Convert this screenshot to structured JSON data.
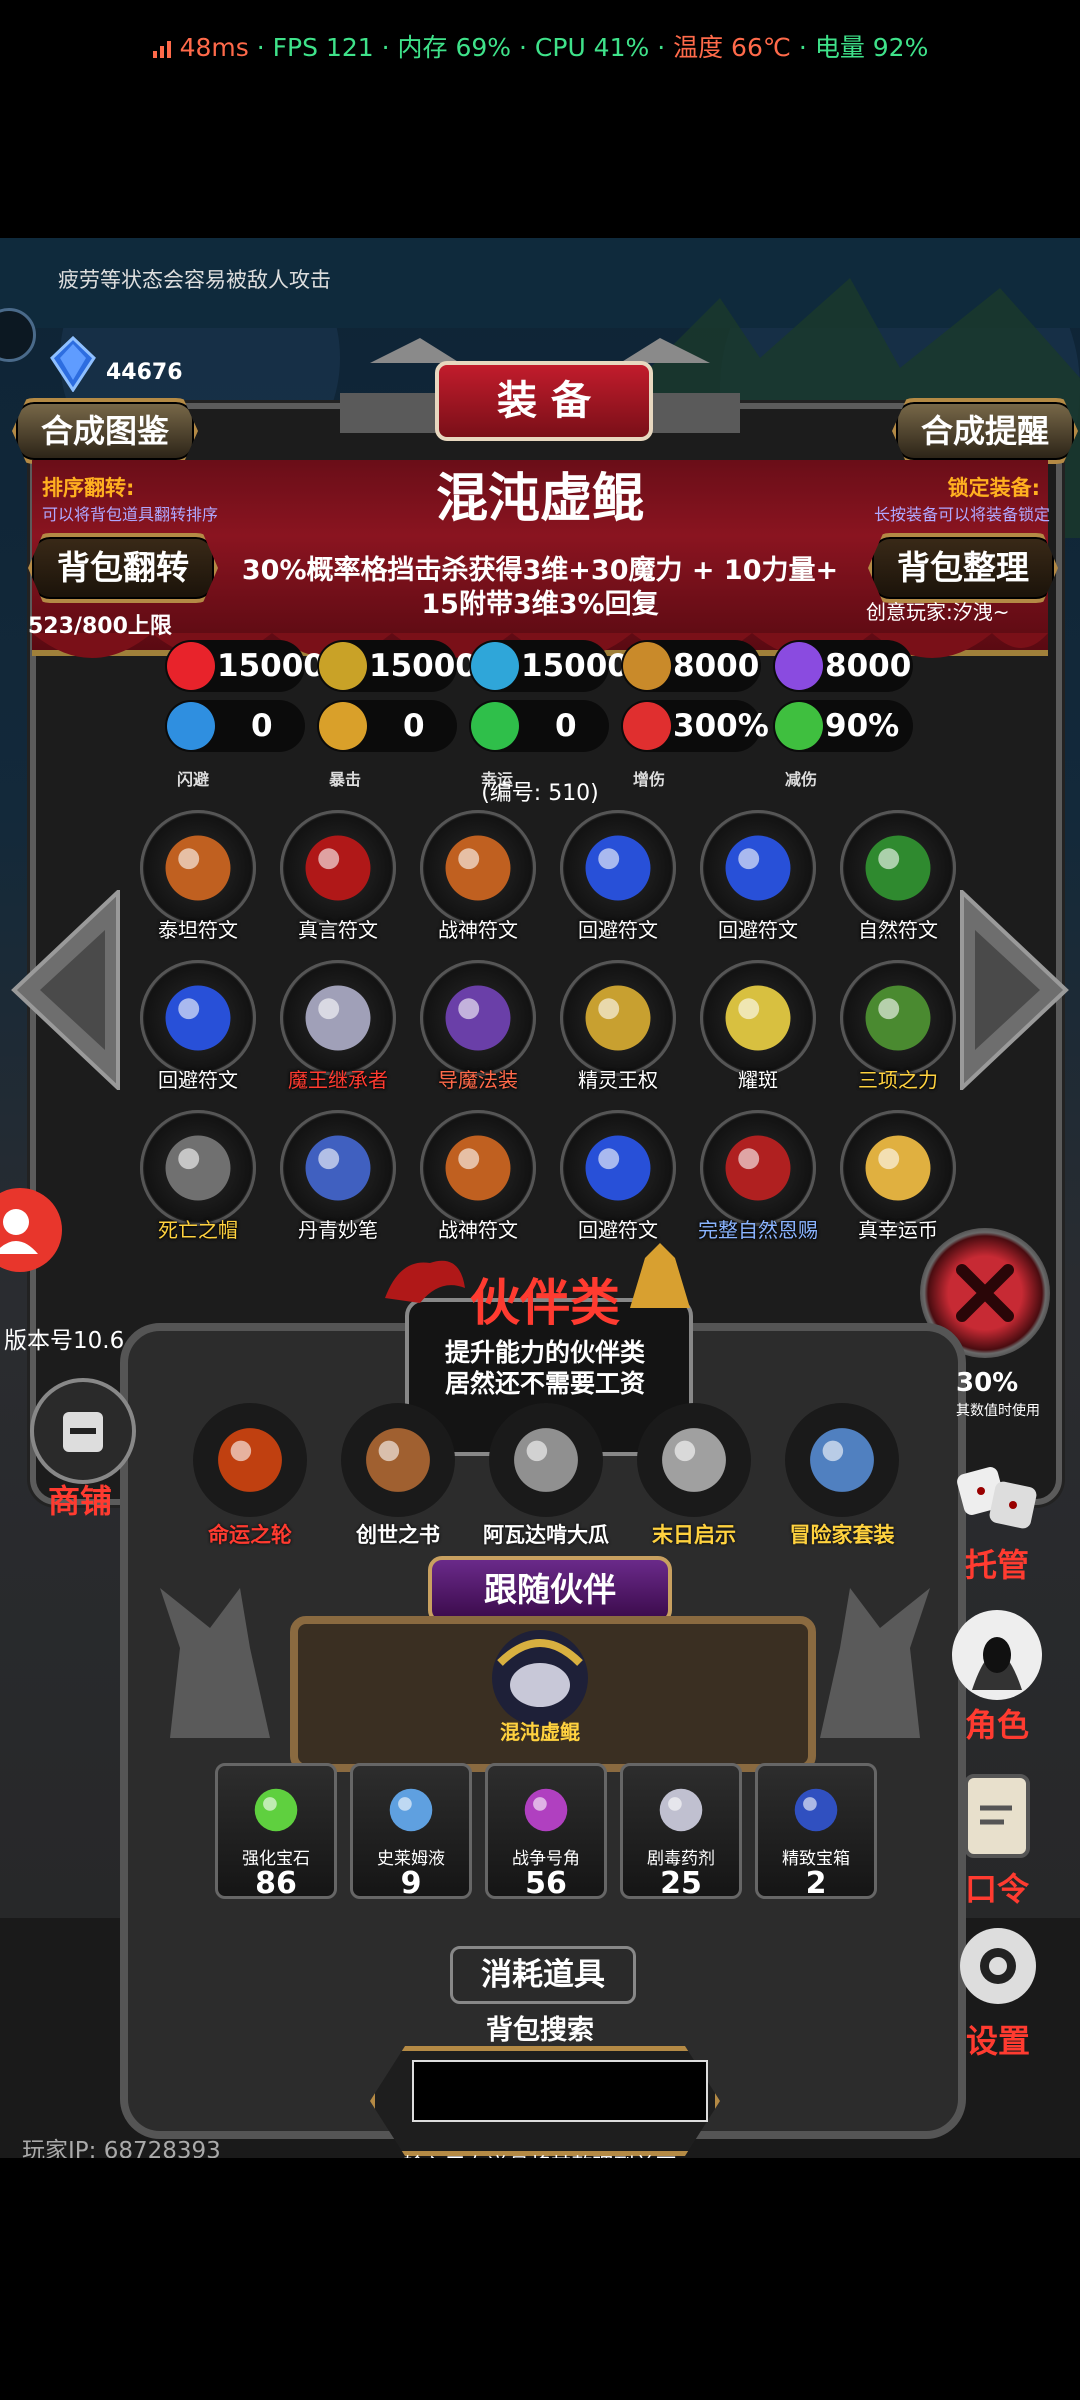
{
  "status_bar": {
    "ping": "48ms",
    "fps": "FPS 121",
    "memory": "内存 69%",
    "cpu": "CPU 41%",
    "temperature": "温度 66℃",
    "battery": "电量 92%",
    "sep": "·"
  },
  "hint": "疲劳等状态会容易被敌人攻击",
  "currency": "44676",
  "header": {
    "title": "装 备",
    "left_button": "合成图鉴",
    "right_button": "合成提醒"
  },
  "sort": {
    "title": "排序翻转:",
    "desc": "可以将背包道具翻转排序",
    "button": "背包翻转",
    "capacity": "523/800上限"
  },
  "lock": {
    "title": "锁定装备:",
    "desc": "长按装备可以将装备锁定",
    "button": "背包整理",
    "creator": "创意玩家:汐洩~"
  },
  "item": {
    "name": "混沌虚鲲",
    "desc_line1": "30%概率格挡击杀获得3维+30魔力 + 10力量+",
    "desc_line2": "15附带3维3%回复",
    "number": "(编号: 510)"
  },
  "stats_row1": [
    {
      "icon": "heart-icon",
      "value": "15000",
      "color": "#e8232b"
    },
    {
      "icon": "strength-icon",
      "value": "15000",
      "color": "#c9a227"
    },
    {
      "icon": "boot-icon",
      "value": "15000",
      "color": "#2fa6d9"
    },
    {
      "icon": "sword-icon",
      "value": "8000",
      "color": "#c98a2a"
    },
    {
      "icon": "lightning-icon",
      "value": "8000",
      "color": "#8a4be0"
    }
  ],
  "stats_row2": [
    {
      "icon": "dodge-icon",
      "value": "0",
      "label": "闪避",
      "color": "#2f8fe0"
    },
    {
      "icon": "crit-icon",
      "value": "0",
      "label": "暴击",
      "color": "#d9a02a"
    },
    {
      "icon": "clover-icon",
      "value": "0",
      "label": "幸运",
      "color": "#2fbf4a"
    },
    {
      "icon": "crossed-swords-icon",
      "value": "300%",
      "label": "增伤",
      "color": "#e02f2f"
    },
    {
      "icon": "shield-icon",
      "value": "90%",
      "label": "减伤",
      "color": "#3fbf3f"
    }
  ],
  "inventory": [
    {
      "label": "泰坦符文",
      "color": "#ffffff",
      "icon": "rune-orange-icon",
      "tint": "#c06020"
    },
    {
      "label": "真言符文",
      "color": "#ffffff",
      "icon": "rune-red-icon",
      "tint": "#b01818"
    },
    {
      "label": "战神符文",
      "color": "#ffffff",
      "icon": "rune-orange-icon",
      "tint": "#c06020"
    },
    {
      "label": "回避符文",
      "color": "#ffffff",
      "icon": "orb-blue-icon",
      "tint": "#2850d8"
    },
    {
      "label": "回避符文",
      "color": "#ffffff",
      "icon": "orb-blue-icon",
      "tint": "#2850d8"
    },
    {
      "label": "自然符文",
      "color": "#ffffff",
      "icon": "leaf-green-icon",
      "tint": "#2f8a2f"
    },
    {
      "label": "回避符文",
      "color": "#ffffff",
      "icon": "orb-blue-icon",
      "tint": "#2850d8"
    },
    {
      "label": "魔王继承者",
      "color": "#ff3b30",
      "icon": "demon-king-icon",
      "tint": "#a0a0b8"
    },
    {
      "label": "导魔法装",
      "color": "#ff6a4a",
      "icon": "mage-robe-icon",
      "tint": "#6a3fa8"
    },
    {
      "label": "精灵王权",
      "color": "#ffffff",
      "icon": "scepter-icon",
      "tint": "#c8a030"
    },
    {
      "label": "耀斑",
      "color": "#ffffff",
      "icon": "flare-axe-icon",
      "tint": "#d8c040"
    },
    {
      "label": "三项之力",
      "color": "#ffd23f",
      "icon": "triforce-sword-icon",
      "tint": "#4a8a30"
    },
    {
      "label": "死亡之帽",
      "color": "#ffd23f",
      "icon": "death-hat-icon",
      "tint": "#707070"
    },
    {
      "label": "丹青妙笔",
      "color": "#ffffff",
      "icon": "brush-icon",
      "tint": "#4060c0"
    },
    {
      "label": "战神符文",
      "color": "#ffffff",
      "icon": "rune-orange-icon",
      "tint": "#c06020"
    },
    {
      "label": "回避符文",
      "color": "#ffffff",
      "icon": "orb-blue-icon",
      "tint": "#2850d8"
    },
    {
      "label": "完整自然恩赐",
      "color": "#8ab4ff",
      "icon": "leaf-red-icon",
      "tint": "#b02020"
    },
    {
      "label": "真幸运币",
      "color": "#ffffff",
      "icon": "coin-icon",
      "tint": "#e0b040"
    }
  ],
  "partner": {
    "title": "伙伴类",
    "desc_line1": "提升能力的伙伴类",
    "desc_line2": "居然还不需要工资",
    "items": [
      {
        "label": "命运之轮",
        "color": "#ff3b30",
        "icon": "wheel-icon",
        "tint": "#c04010"
      },
      {
        "label": "创世之书",
        "color": "#ffffff",
        "icon": "book-icon",
        "tint": "#a06030"
      },
      {
        "label": "阿瓦达啃大瓜",
        "color": "#ffffff",
        "icon": "mace-icon",
        "tint": "#909090"
      },
      {
        "label": "末日启示",
        "color": "#ffd23f",
        "icon": "axes-icon",
        "tint": "#a0a0a0"
      },
      {
        "label": "冒险家套装",
        "color": "#ffd23f",
        "icon": "adventurer-icon",
        "tint": "#5080c0"
      }
    ],
    "follow_title": "跟随伙伴",
    "follow_name": "混沌虚鲲"
  },
  "consumables": {
    "title": "消耗道具",
    "items": [
      {
        "label": "强化宝石",
        "count": "86",
        "icon": "gem-green-icon",
        "tint": "#5fd03f"
      },
      {
        "label": "史莱姆液",
        "count": "9",
        "icon": "potion-blue-icon",
        "tint": "#5fa0e0"
      },
      {
        "label": "战争号角",
        "count": "56",
        "icon": "horn-icon",
        "tint": "#b040c0"
      },
      {
        "label": "剧毒药剂",
        "count": "25",
        "icon": "poison-icon",
        "tint": "#c0c0d0"
      },
      {
        "label": "精致宝箱",
        "count": "2",
        "icon": "chest-icon",
        "tint": "#3050c0"
      }
    ]
  },
  "search": {
    "title": "背包搜索",
    "placeholder": "",
    "hint": "输入已有道具将其整理到首页"
  },
  "side_menu": {
    "shop": "商铺",
    "manage": "托管",
    "role": "角色",
    "code": "口令",
    "settings": "设置",
    "value_pct": "30%",
    "value_note": "其数值时使用"
  },
  "version": "版本号10.6",
  "player_ip": "玩家IP: 68728393",
  "colors": {
    "accent_red": "#ff3b30",
    "gold": "#b48a45",
    "banner": "#8a1420"
  }
}
